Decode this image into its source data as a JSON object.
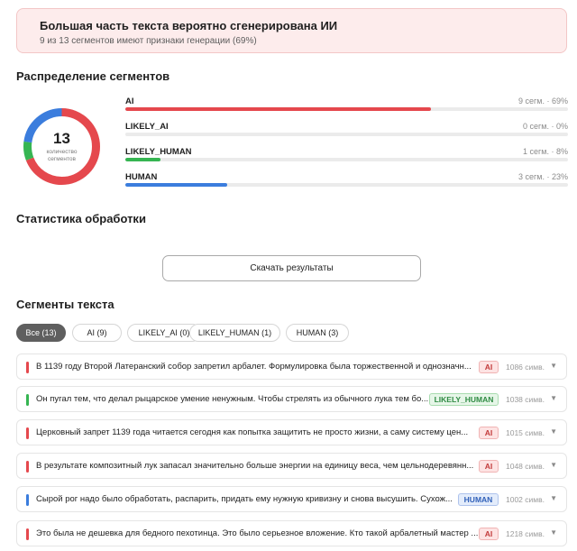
{
  "alert": {
    "title": "Большая часть текста вероятно сгенерирована ИИ",
    "subtitle": "9 из 13 сегментов имеют признаки генерации (69%)"
  },
  "distribution": {
    "heading": "Распределение сегментов",
    "total": "13",
    "total_label": "количество сегментов",
    "rows": [
      {
        "name": "AI",
        "stat": "9 сегм. · 69%",
        "percent": 69,
        "color": "#e5484d"
      },
      {
        "name": "LIKELY_AI",
        "stat": "0 сегм. · 0%",
        "percent": 0,
        "color": "#f08c3a"
      },
      {
        "name": "LIKELY_HUMAN",
        "stat": "1 сегм. · 8%",
        "percent": 8,
        "color": "#36b552"
      },
      {
        "name": "HUMAN",
        "stat": "3 сегм. · 23%",
        "percent": 23,
        "color": "#3b7ddd"
      }
    ]
  },
  "stats": {
    "heading": "Статистика обработки",
    "download_label": "Скачать результаты"
  },
  "segments": {
    "heading": "Сегменты текста",
    "filters": [
      {
        "label": "Все (13)",
        "active": true
      },
      {
        "label": "AI (9)",
        "active": false
      },
      {
        "label": "LIKELY_AI (0)",
        "active": false
      },
      {
        "label": "LIKELY_HUMAN (1)",
        "active": false
      },
      {
        "label": "HUMAN (3)",
        "active": false
      }
    ],
    "items": [
      {
        "text": "В 1139 году Второй Латеранский собор запретил арбалет. Формулировка была торжественной и однозначн...",
        "label": "AI",
        "length": "1086 симв.",
        "kind": "ai",
        "color": "#e5484d"
      },
      {
        "text": "Он пугал тем, что делал рыцарское умение ненужным. Чтобы стрелять из обычного лука тем бо...",
        "label": "LIKELY_HUMAN",
        "length": "1038 симв.",
        "kind": "lh",
        "color": "#36b552"
      },
      {
        "text": "Церковный запрет 1139 года читается сегодня как попытка защитить не просто жизни, а саму систему цен...",
        "label": "AI",
        "length": "1015 симв.",
        "kind": "ai",
        "color": "#e5484d"
      },
      {
        "text": "В результате композитный лук запасал значительно больше энергии на единицу веса, чем цельнодеревянн...",
        "label": "AI",
        "length": "1048 симв.",
        "kind": "ai",
        "color": "#e5484d"
      },
      {
        "text": "Сырой рог надо было обработать, распарить, придать ему нужную кривизну и снова высушить. Сухож...",
        "label": "HUMAN",
        "length": "1002 симв.",
        "kind": "h",
        "color": "#3b7ddd"
      },
      {
        "text": "Это была не дешевка для бедного пехотинца. Это было серьезное вложение. Кто такой арбалетный мастер ...",
        "label": "AI",
        "length": "1218 симв.",
        "kind": "ai",
        "color": "#e5484d"
      }
    ]
  }
}
